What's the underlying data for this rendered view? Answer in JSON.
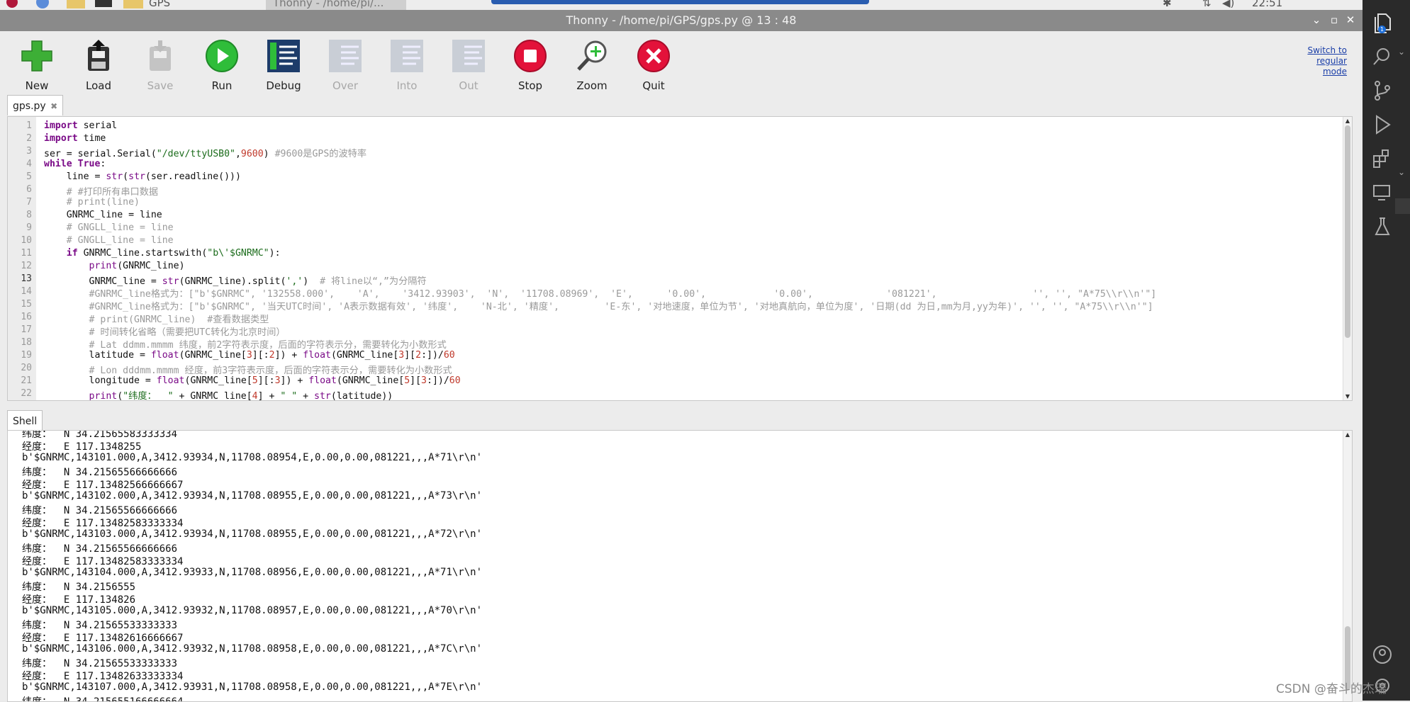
{
  "taskbar": {
    "folder_label": "GPS",
    "task_label": "Thonny  -  /home/pi/...",
    "clock": "22:51"
  },
  "window": {
    "title": "Thonny  -  /home/pi/GPS/gps.py  @  13 : 48"
  },
  "toolbar": {
    "buttons": [
      {
        "label": "New",
        "icon": "new-file-plus-icon",
        "enabled": true
      },
      {
        "label": "Load",
        "icon": "load-file-icon",
        "enabled": true
      },
      {
        "label": "Save",
        "icon": "save-icon",
        "enabled": false
      },
      {
        "label": "Run",
        "icon": "run-play-icon",
        "enabled": true
      },
      {
        "label": "Debug",
        "icon": "debug-icon",
        "enabled": true
      },
      {
        "label": "Over",
        "icon": "step-over-icon",
        "enabled": false
      },
      {
        "label": "Into",
        "icon": "step-into-icon",
        "enabled": false
      },
      {
        "label": "Out",
        "icon": "step-out-icon",
        "enabled": false
      },
      {
        "label": "Stop",
        "icon": "stop-icon",
        "enabled": true
      },
      {
        "label": "Zoom",
        "icon": "zoom-icon",
        "enabled": true
      },
      {
        "label": "Quit",
        "icon": "quit-icon",
        "enabled": true
      }
    ],
    "switch_mode": [
      "Switch to",
      "regular",
      "mode"
    ]
  },
  "editor": {
    "tab_label": "gps.py",
    "current_line": 13,
    "line_numbers": [
      "1",
      "2",
      "3",
      "4",
      "5",
      "6",
      "7",
      "8",
      "9",
      "10",
      "11",
      "12",
      "13",
      "14",
      "15",
      "16",
      "17",
      "18",
      "19",
      "20",
      "21",
      "22"
    ],
    "lines": [
      "import serial",
      "import time",
      "ser = serial.Serial(\"/dev/ttyUSB0\",9600) #9600是GPS的波特率",
      "while True:",
      "    line = str(str(ser.readline()))",
      "    # #打印所有串口数据",
      "    # print(line)",
      "    GNRMC_line = line",
      "    # GNGLL_line = line",
      "    # GNGLL_line = line",
      "    if GNRMC_line.startswith(\"b\\'$GNRMC\"):",
      "        print(GNRMC_line)",
      "        GNRMC_line = str(GNRMC_line).split(',')  # 将line以“,”为分隔符",
      "        #GNRMC_line格式为：[\"b'$GNRMC\", '132558.000',    'A',    '3412.93903',  'N',  '11708.08969',  'E',      '0.00',            '0.00',             '081221',                 '', '', \"A*75\\\\r\\\\n'\"]",
      "        #GNRMC_line格式为：[\"b'$GNRMC\", '当天UTC时间', 'A表示数据有效', '纬度',    'N-北', '精度',        'E-东', '对地速度，单位为节', '对地真航向，单位为度', '日期(dd 为日,mm为月,yy为年)', '', '', \"A*75\\\\r\\\\n'\"]",
      "        # print(GNRMC_line)  #查看数据类型",
      "        # 时间转化省略（需要把UTC转化为北京时间）",
      "        # Lat ddmm.mmmm 纬度，前2字符表示度，后面的字符表示分，需要转化为小数形式",
      "        latitude = float(GNRMC_line[3][:2]) + float(GNRMC_line[3][2:])/60",
      "        # Lon dddmm.mmmm 经度，前3字符表示度，后面的字符表示分，需要转化为小数形式",
      "        longitude = float(GNRMC_line[5][:3]) + float(GNRMC_line[5][3:])/60",
      "        print(\"纬度：  \" + GNRMC_line[4] + \" \" + str(latitude))"
    ]
  },
  "shell": {
    "tab_label": "Shell",
    "lines": [
      "纬度：  N 34.21565583333334",
      "经度：  E 117.1348255",
      "b'$GNRMC,143101.000,A,3412.93934,N,11708.08954,E,0.00,0.00,081221,,,A*71\\r\\n'",
      "纬度：  N 34.21565566666666",
      "经度：  E 117.13482566666667",
      "b'$GNRMC,143102.000,A,3412.93934,N,11708.08955,E,0.00,0.00,081221,,,A*73\\r\\n'",
      "纬度：  N 34.21565566666666",
      "经度：  E 117.13482583333334",
      "b'$GNRMC,143103.000,A,3412.93934,N,11708.08955,E,0.00,0.00,081221,,,A*72\\r\\n'",
      "纬度：  N 34.21565566666666",
      "经度：  E 117.13482583333334",
      "b'$GNRMC,143104.000,A,3412.93933,N,11708.08956,E,0.00,0.00,081221,,,A*71\\r\\n'",
      "纬度：  N 34.2156555",
      "经度：  E 117.134826",
      "b'$GNRMC,143105.000,A,3412.93932,N,11708.08957,E,0.00,0.00,081221,,,A*70\\r\\n'",
      "纬度：  N 34.21565533333333",
      "经度：  E 117.13482616666667",
      "b'$GNRMC,143106.000,A,3412.93932,N,11708.08958,E,0.00,0.00,081221,,,A*7C\\r\\n'",
      "纬度：  N 34.21565533333333",
      "经度：  E 117.13482633333334",
      "b'$GNRMC,143107.000,A,3412.93931,N,11708.08958,E,0.00,0.00,081221,,,A*7E\\r\\n'",
      "纬度：  N 34.215655166666664"
    ]
  },
  "activity_bar": {
    "icons": [
      "explorer-icon",
      "search-icon",
      "source-control-icon",
      "run-debug-icon",
      "extensions-icon",
      "remote-explorer-icon",
      "testing-icon",
      "account-icon",
      "settings-gear-icon"
    ],
    "badge": "1"
  },
  "watermark": "CSDN @奋斗的杰瑞",
  "colors": {
    "titlebar": "#8a8a8a",
    "keyword": "#7a0a87",
    "string": "#1a6b1a",
    "number": "#c0392b",
    "comment": "#9a9a9a",
    "activity_bar": "#2a2a2a"
  }
}
